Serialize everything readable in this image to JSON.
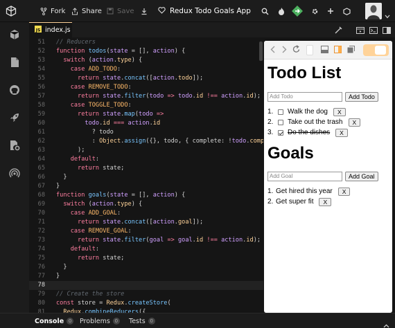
{
  "app": {
    "title": "Redux Todo Goals App",
    "actions": {
      "fork": "Fork",
      "share": "Share",
      "save": "Save"
    }
  },
  "editor": {
    "active_tab": "index.js",
    "active_line": 78,
    "lines": [
      {
        "n": "51",
        "t": [
          [
            "cm",
            "// Reducers"
          ]
        ]
      },
      {
        "n": "52",
        "t": [
          [
            "kw",
            "function "
          ],
          [
            "fn",
            "todos"
          ],
          [
            "src",
            "("
          ],
          [
            "pm",
            "state"
          ],
          [
            "src",
            " = [], "
          ],
          [
            "pm",
            "action"
          ],
          [
            "src",
            ") {"
          ]
        ]
      },
      {
        "n": "53",
        "t": [
          [
            "src",
            "  "
          ],
          [
            "kw",
            "switch "
          ],
          [
            "src",
            "("
          ],
          [
            "pm",
            "action"
          ],
          [
            "src",
            "."
          ],
          [
            "ob",
            "type"
          ],
          [
            "src",
            ") {"
          ]
        ]
      },
      {
        "n": "54",
        "t": [
          [
            "src",
            "    "
          ],
          [
            "kw",
            "case "
          ],
          [
            "ct",
            "ADD_TODO"
          ],
          [
            "src",
            ":"
          ]
        ]
      },
      {
        "n": "55",
        "t": [
          [
            "src",
            "      "
          ],
          [
            "kw",
            "return "
          ],
          [
            "pm",
            "state"
          ],
          [
            "src",
            "."
          ],
          [
            "fn",
            "concat"
          ],
          [
            "src",
            "(["
          ],
          [
            "pm",
            "action"
          ],
          [
            "src",
            "."
          ],
          [
            "ob",
            "todo"
          ],
          [
            "src",
            "]);"
          ]
        ]
      },
      {
        "n": "56",
        "t": [
          [
            "src",
            "    "
          ],
          [
            "kw",
            "case "
          ],
          [
            "ct",
            "REMOVE_TODO"
          ],
          [
            "src",
            ":"
          ]
        ]
      },
      {
        "n": "57",
        "t": [
          [
            "src",
            "      "
          ],
          [
            "kw",
            "return "
          ],
          [
            "pm",
            "state"
          ],
          [
            "src",
            "."
          ],
          [
            "fn",
            "filter"
          ],
          [
            "src",
            "("
          ],
          [
            "pm",
            "todo"
          ],
          [
            "op",
            " => "
          ],
          [
            "pm",
            "todo"
          ],
          [
            "src",
            "."
          ],
          [
            "ob",
            "id"
          ],
          [
            "op",
            " !== "
          ],
          [
            "pm",
            "action"
          ],
          [
            "src",
            "."
          ],
          [
            "ob",
            "id"
          ],
          [
            "src",
            ");"
          ]
        ]
      },
      {
        "n": "58",
        "t": [
          [
            "src",
            "    "
          ],
          [
            "kw",
            "case "
          ],
          [
            "ct",
            "TOGGLE_TODO"
          ],
          [
            "src",
            ":"
          ]
        ]
      },
      {
        "n": "59",
        "t": [
          [
            "src",
            "      "
          ],
          [
            "kw",
            "return "
          ],
          [
            "pm",
            "state"
          ],
          [
            "src",
            "."
          ],
          [
            "fn",
            "map"
          ],
          [
            "src",
            "("
          ],
          [
            "pm",
            "todo"
          ],
          [
            "op",
            " =>"
          ]
        ]
      },
      {
        "n": "60",
        "t": [
          [
            "src",
            "        "
          ],
          [
            "pm",
            "todo"
          ],
          [
            "src",
            "."
          ],
          [
            "ob",
            "id"
          ],
          [
            "op",
            " === "
          ],
          [
            "pm",
            "action"
          ],
          [
            "src",
            "."
          ],
          [
            "ob",
            "id"
          ]
        ]
      },
      {
        "n": "61",
        "t": [
          [
            "src",
            "          ? "
          ],
          [
            "src",
            "todo"
          ]
        ]
      },
      {
        "n": "62",
        "t": [
          [
            "src",
            "          : "
          ],
          [
            "ob",
            "Object"
          ],
          [
            "src",
            "."
          ],
          [
            "fn",
            "assign"
          ],
          [
            "src",
            "({}, todo, { complete: !"
          ],
          [
            "pm",
            "todo"
          ],
          [
            "src",
            "."
          ],
          [
            "ob",
            "complete"
          ]
        ]
      },
      {
        "n": "63",
        "t": [
          [
            "src",
            "      );"
          ]
        ]
      },
      {
        "n": "64",
        "t": [
          [
            "src",
            "    "
          ],
          [
            "kw",
            "default"
          ],
          [
            "src",
            ":"
          ]
        ]
      },
      {
        "n": "65",
        "t": [
          [
            "src",
            "      "
          ],
          [
            "kw",
            "return "
          ],
          [
            "src",
            "state;"
          ]
        ]
      },
      {
        "n": "66",
        "t": [
          [
            "src",
            "  }"
          ]
        ]
      },
      {
        "n": "67",
        "t": [
          [
            "src",
            "}"
          ]
        ]
      },
      {
        "n": "68",
        "t": [
          [
            "kw",
            "function "
          ],
          [
            "fn",
            "goals"
          ],
          [
            "src",
            "("
          ],
          [
            "pm",
            "state"
          ],
          [
            "src",
            " = [], "
          ],
          [
            "pm",
            "action"
          ],
          [
            "src",
            ") {"
          ]
        ]
      },
      {
        "n": "69",
        "t": [
          [
            "src",
            "  "
          ],
          [
            "kw",
            "switch "
          ],
          [
            "src",
            "("
          ],
          [
            "pm",
            "action"
          ],
          [
            "src",
            "."
          ],
          [
            "ob",
            "type"
          ],
          [
            "src",
            ") {"
          ]
        ]
      },
      {
        "n": "70",
        "t": [
          [
            "src",
            "    "
          ],
          [
            "kw",
            "case "
          ],
          [
            "ct",
            "ADD_GOAL"
          ],
          [
            "src",
            ":"
          ]
        ]
      },
      {
        "n": "71",
        "t": [
          [
            "src",
            "      "
          ],
          [
            "kw",
            "return "
          ],
          [
            "pm",
            "state"
          ],
          [
            "src",
            "."
          ],
          [
            "fn",
            "concat"
          ],
          [
            "src",
            "(["
          ],
          [
            "pm",
            "action"
          ],
          [
            "src",
            "."
          ],
          [
            "ob",
            "goal"
          ],
          [
            "src",
            "]);"
          ]
        ]
      },
      {
        "n": "72",
        "t": [
          [
            "src",
            "    "
          ],
          [
            "kw",
            "case "
          ],
          [
            "ct",
            "REMOVE_GOAL"
          ],
          [
            "src",
            ":"
          ]
        ]
      },
      {
        "n": "73",
        "t": [
          [
            "src",
            "      "
          ],
          [
            "kw",
            "return "
          ],
          [
            "pm",
            "state"
          ],
          [
            "src",
            "."
          ],
          [
            "fn",
            "filter"
          ],
          [
            "src",
            "("
          ],
          [
            "pm",
            "goal"
          ],
          [
            "op",
            " => "
          ],
          [
            "pm",
            "goal"
          ],
          [
            "src",
            "."
          ],
          [
            "ob",
            "id"
          ],
          [
            "op",
            " !== "
          ],
          [
            "pm",
            "action"
          ],
          [
            "src",
            "."
          ],
          [
            "ob",
            "id"
          ],
          [
            "src",
            ");"
          ]
        ]
      },
      {
        "n": "74",
        "t": [
          [
            "src",
            "    "
          ],
          [
            "kw",
            "default"
          ],
          [
            "src",
            ":"
          ]
        ]
      },
      {
        "n": "75",
        "t": [
          [
            "src",
            "      "
          ],
          [
            "kw",
            "return "
          ],
          [
            "src",
            "state;"
          ]
        ]
      },
      {
        "n": "76",
        "t": [
          [
            "src",
            "  }"
          ]
        ]
      },
      {
        "n": "77",
        "t": [
          [
            "src",
            "}"
          ]
        ]
      },
      {
        "n": "78",
        "t": [
          [
            "src",
            ""
          ]
        ]
      },
      {
        "n": "79",
        "t": [
          [
            "cm",
            "// Create the store"
          ]
        ]
      },
      {
        "n": "80",
        "t": [
          [
            "kw",
            "const "
          ],
          [
            "src",
            "store = "
          ],
          [
            "ob",
            "Redux"
          ],
          [
            "src",
            "."
          ],
          [
            "fn",
            "createStore"
          ],
          [
            "src",
            "("
          ]
        ]
      },
      {
        "n": "81",
        "t": [
          [
            "src",
            "  "
          ],
          [
            "ob",
            "Redux"
          ],
          [
            "src",
            "."
          ],
          [
            "fn",
            "combineReducers"
          ],
          [
            "src",
            "({"
          ]
        ]
      }
    ]
  },
  "preview": {
    "todo_heading": "Todo List",
    "todo_placeholder": "Add Todo",
    "todo_button": "Add Todo",
    "todos": [
      {
        "num": "1.",
        "text": "Walk the dog",
        "done": false
      },
      {
        "num": "2.",
        "text": "Take out the trash",
        "done": false
      },
      {
        "num": "3.",
        "text": "Do the dishes",
        "done": true
      }
    ],
    "goals_heading": "Goals",
    "goal_placeholder": "Add Goal",
    "goal_button": "Add Goal",
    "goals": [
      {
        "num": "1.",
        "text": "Get hired this year"
      },
      {
        "num": "2.",
        "text": "Get super fit"
      }
    ],
    "remove_label": "X"
  },
  "bottom": {
    "tabs": [
      {
        "label": "Console",
        "count": "0",
        "active": true
      },
      {
        "label": "Problems",
        "count": "0",
        "active": false
      },
      {
        "label": "Tests",
        "count": "0",
        "active": false
      }
    ]
  },
  "colors": {
    "accent": "#ffd399",
    "editor_bg": "#151515",
    "chrome_bg": "#1c1c1c"
  }
}
